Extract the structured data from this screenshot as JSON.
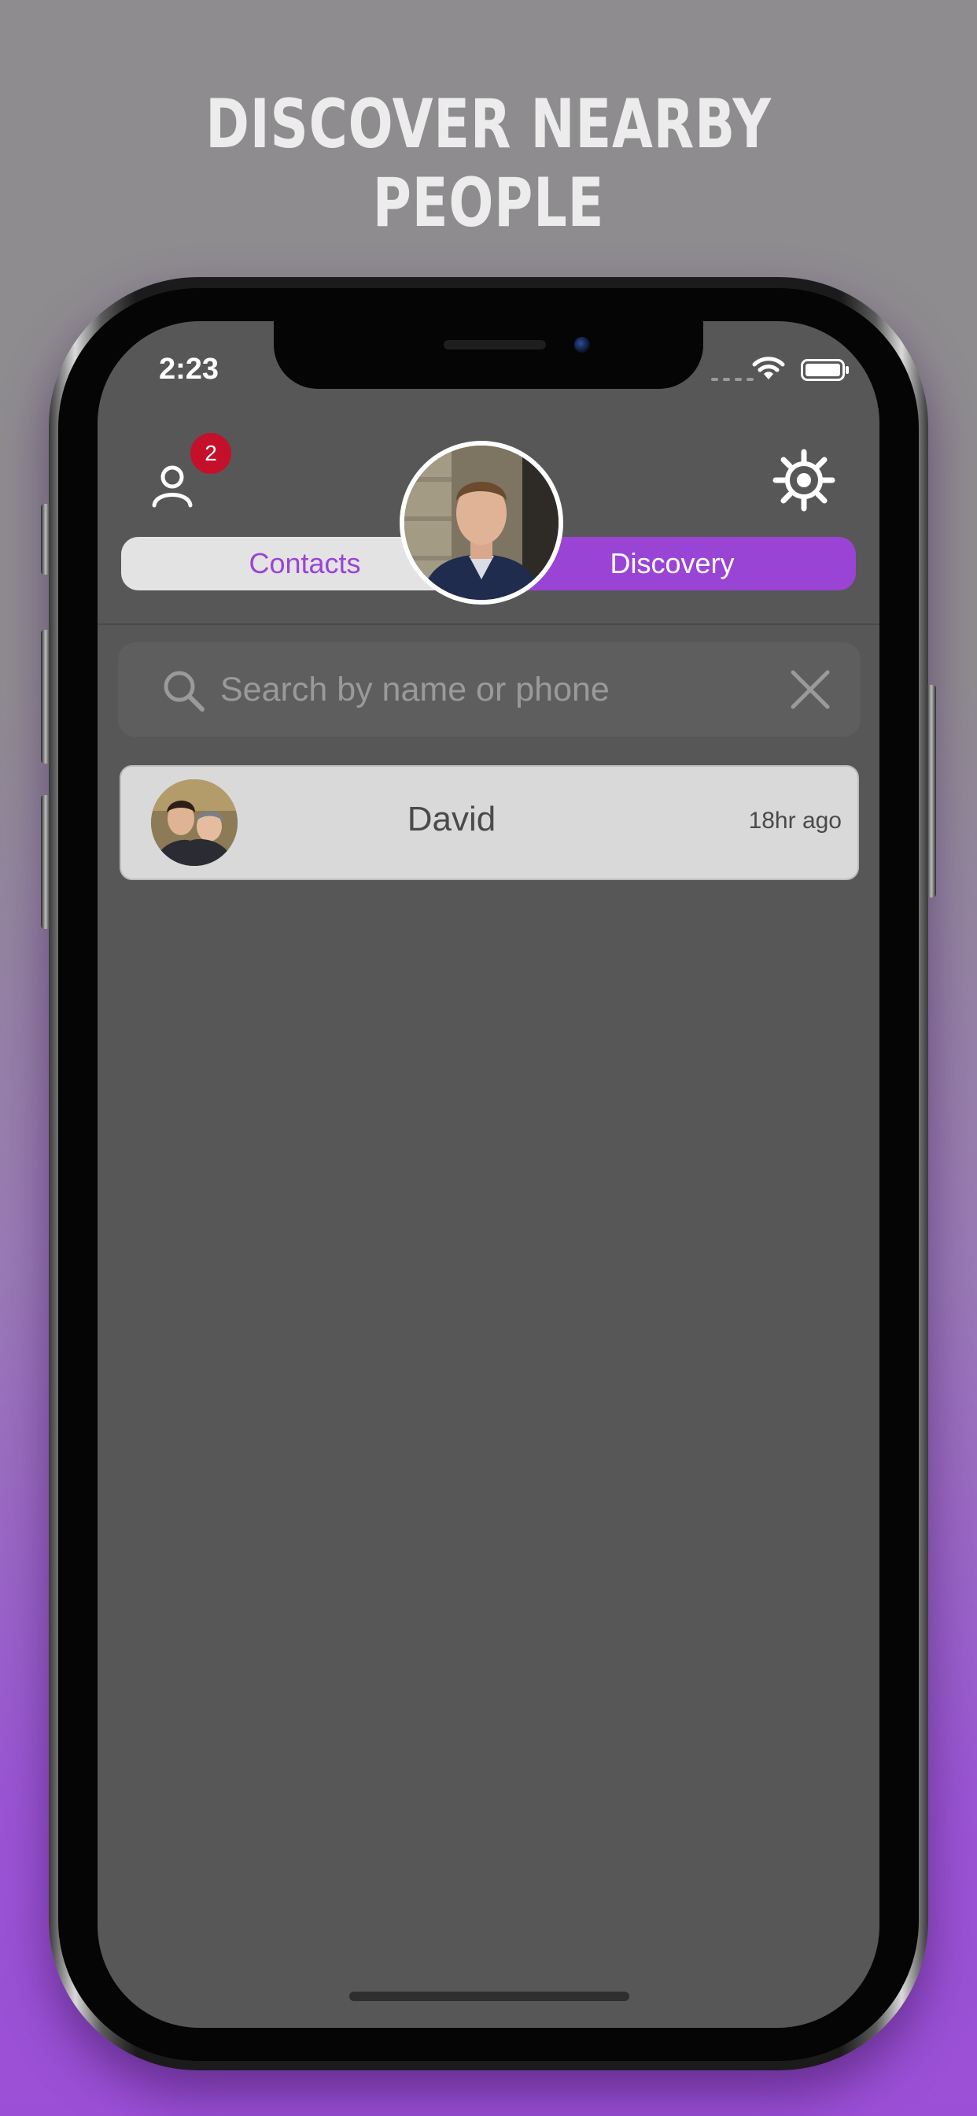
{
  "promo": {
    "headline": "DISCOVER NEARBY PEOPLE"
  },
  "status_bar": {
    "time": "2:23",
    "icons": [
      "cellular-signal-icon",
      "wifi-icon",
      "battery-icon"
    ]
  },
  "header": {
    "profile_icon": "person-icon",
    "notification_count": "2",
    "settings_icon": "gear-icon",
    "tabs": [
      {
        "label": "Contacts",
        "selected": false
      },
      {
        "label": "Discovery",
        "selected": true
      }
    ]
  },
  "search": {
    "placeholder": "Search by name or phone",
    "value": "",
    "clear_icon": "close-icon"
  },
  "people": [
    {
      "name": "David",
      "last_seen": "18hr ago"
    }
  ],
  "colors": {
    "accent": "#9a44d6",
    "badge": "#c4102a",
    "screen_background": "#575757",
    "card_background": "#d9d9d9"
  }
}
